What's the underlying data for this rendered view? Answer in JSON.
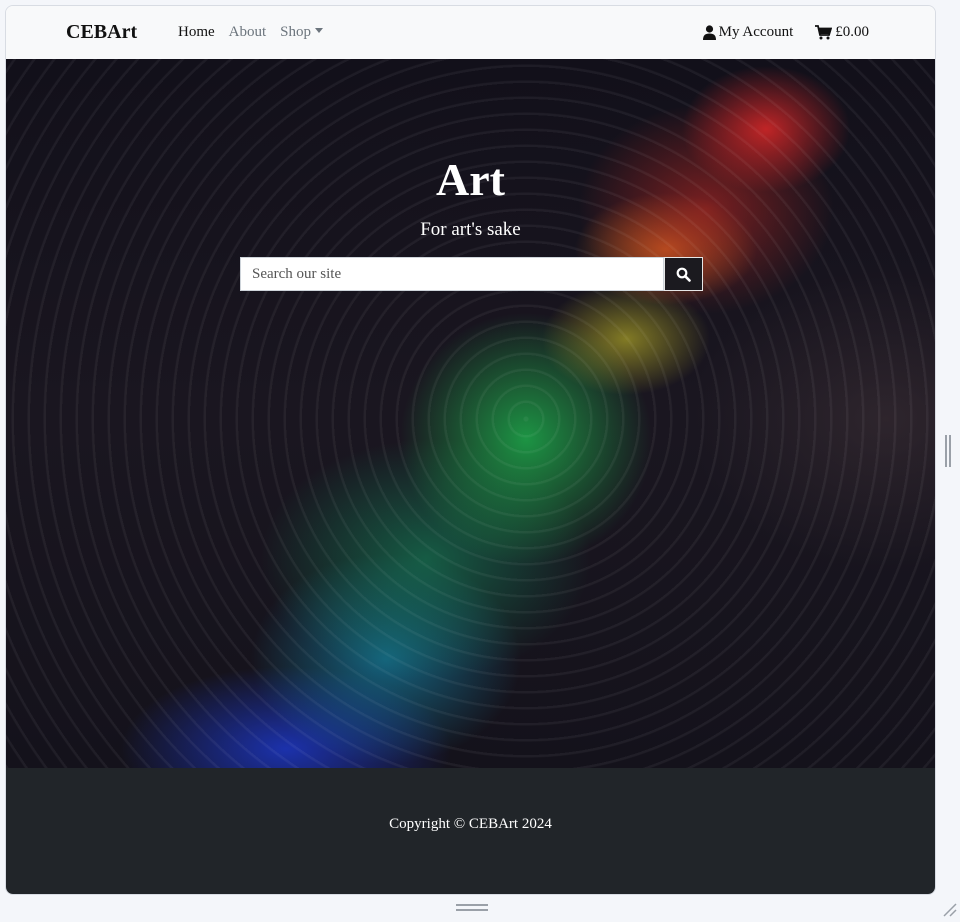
{
  "navbar": {
    "brand": "CEBArt",
    "links": [
      {
        "label": "Home"
      },
      {
        "label": "About"
      },
      {
        "label": "Shop"
      }
    ],
    "account_label": "My Account",
    "cart_total": "£0.00"
  },
  "hero": {
    "title": "Art",
    "subtitle": "For art's sake",
    "search_placeholder": "Search our site"
  },
  "footer": {
    "copyright": "Copyright © CEBArt 2024"
  },
  "icons": {
    "account": "user-icon",
    "cart": "shopping-cart-icon",
    "search": "search-icon",
    "dropdown": "chevron-down-icon"
  }
}
